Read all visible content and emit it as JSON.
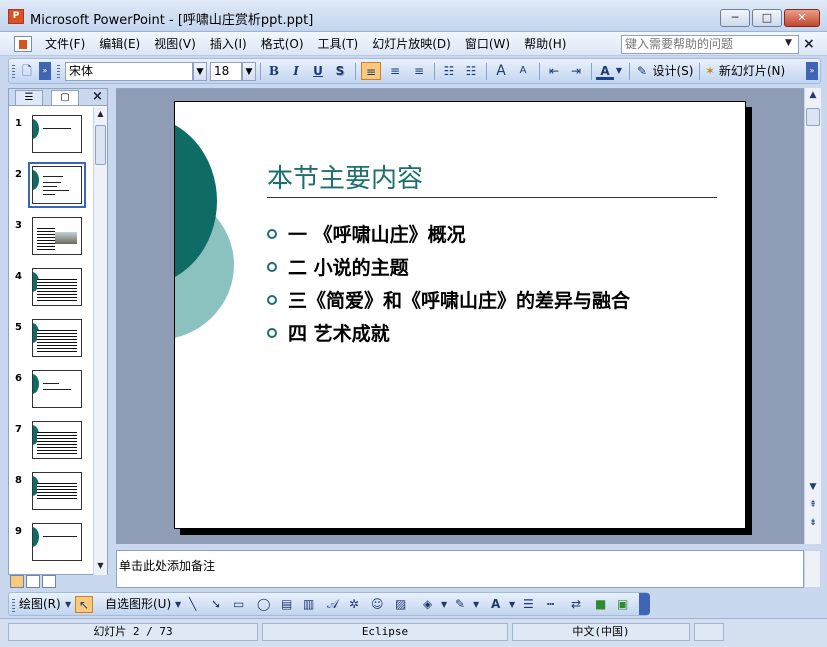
{
  "window": {
    "app_icon_glyph": "P",
    "title": "Microsoft PowerPoint - [呼啸山庄赏析ppt.ppt]",
    "minimize_label": "─",
    "maximize_label": "□",
    "close_label": "✕"
  },
  "menu": {
    "items": [
      "文件(F)",
      "编辑(E)",
      "视图(V)",
      "插入(I)",
      "格式(O)",
      "工具(T)",
      "幻灯片放映(D)",
      "窗口(W)",
      "帮助(H)"
    ],
    "help_placeholder": "键入需要帮助的问题",
    "doc_close": "×"
  },
  "toolbar": {
    "font_name": "宋体",
    "font_size": "18",
    "bold": "B",
    "italic": "I",
    "underline": "U",
    "shadow": "S",
    "grow_font": "A",
    "shrink_font": "A",
    "font_color": "A",
    "design_label": "设计(S)",
    "new_slide_label": "新幻灯片(N)"
  },
  "slides_pane": {
    "tab_outline": "☰",
    "tab_slides": "▢",
    "close": "×",
    "slide_numbers": [
      "1",
      "2",
      "3",
      "4",
      "5",
      "6",
      "7",
      "8",
      "9"
    ],
    "selected_slide": 2
  },
  "slide": {
    "title": "本节主要内容",
    "bullets": [
      "一 《呼啸山庄》概况",
      "二 小说的主题",
      "三《简爱》和《呼啸山庄》的差异与融合",
      "四 艺术成就"
    ],
    "theme_dark": "#0e6b66",
    "theme_light": "#8bc2c0",
    "title_color": "#1f6f6e"
  },
  "notes": {
    "placeholder": "单击此处添加备注"
  },
  "drawing_toolbar": {
    "draw_label": "绘图(R)",
    "autoshapes_label": "自选图形(U)"
  },
  "status": {
    "slide_position": "幻灯片 2 / 73",
    "design_name": "Eclipse",
    "language": "中文(中国)"
  }
}
